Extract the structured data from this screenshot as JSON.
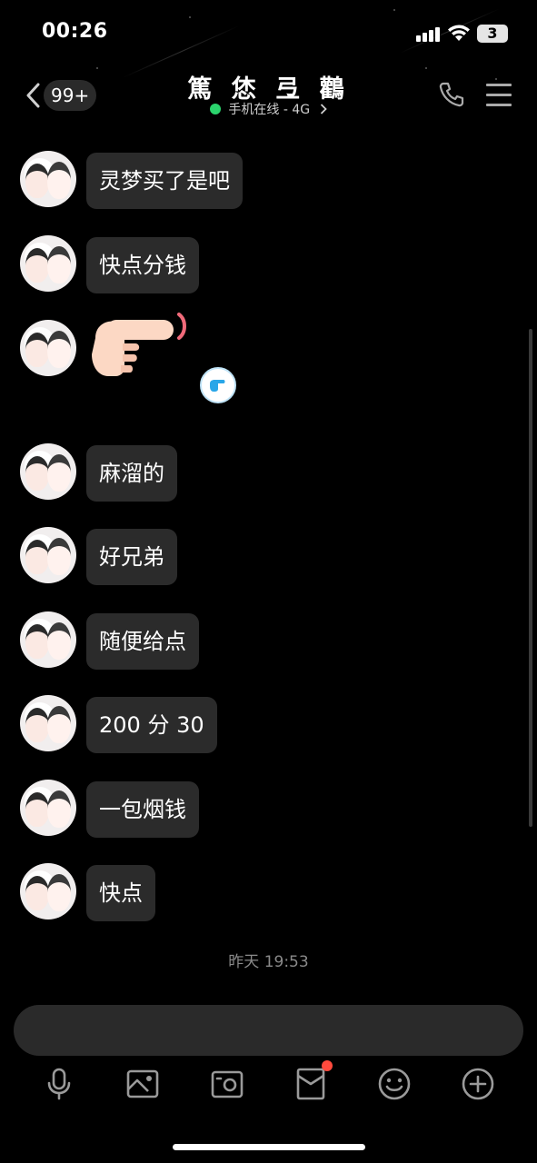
{
  "status_bar": {
    "time": "00:26",
    "battery_level": "3"
  },
  "header": {
    "unread_count": "99+",
    "title": "篤 恷 弖 鸛",
    "presence_text": "手机在线 - 4G",
    "presence_color": "#2bd46d"
  },
  "messages": [
    {
      "type": "text",
      "text": "灵梦买了是吧"
    },
    {
      "type": "text",
      "text": "快点分钱"
    },
    {
      "type": "sticker",
      "sticker_name": "pointing-hand-sticker"
    },
    {
      "type": "text",
      "text": "麻溜的"
    },
    {
      "type": "text",
      "text": "好兄弟"
    },
    {
      "type": "text",
      "text": "随便给点"
    },
    {
      "type": "text",
      "text": "200 分 30"
    },
    {
      "type": "text",
      "text": "一包烟钱"
    },
    {
      "type": "text",
      "text": "快点"
    }
  ],
  "time_divider": "昨天 19:53",
  "input": {
    "placeholder": ""
  },
  "toolbar": {
    "icons": [
      "microphone-icon",
      "image-icon",
      "camera-icon",
      "red-packet-icon",
      "emoji-icon",
      "plus-icon"
    ]
  },
  "colors": {
    "background": "#000000",
    "bubble": "#2b2b2b",
    "notification_dot": "#ff4a3d"
  }
}
